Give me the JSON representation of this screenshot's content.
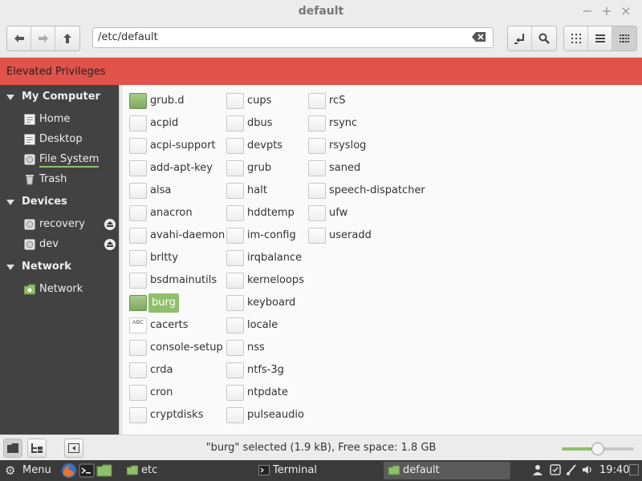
{
  "window": {
    "title": "default"
  },
  "toolbar": {
    "location": "/etc/default",
    "buttons": [
      "back-icon",
      "forward-icon",
      "up-icon",
      "toggle-location-icon",
      "search-icon",
      "icon-view-icon",
      "list-view-icon",
      "compact-view-icon"
    ]
  },
  "infobar": {
    "text": "Elevated Privileges"
  },
  "sidebar": {
    "sections": [
      {
        "label": "My Computer",
        "items": [
          {
            "label": "Home",
            "icon": "home-icon"
          },
          {
            "label": "Desktop",
            "icon": "desktop-icon"
          },
          {
            "label": "File System",
            "icon": "drive-icon",
            "selected": true
          },
          {
            "label": "Trash",
            "icon": "trash-icon"
          }
        ]
      },
      {
        "label": "Devices",
        "items": [
          {
            "label": "recovery",
            "icon": "drive-icon",
            "eject": true
          },
          {
            "label": "dev",
            "icon": "drive-icon",
            "eject": true
          }
        ]
      },
      {
        "label": "Network",
        "items": [
          {
            "label": "Network",
            "icon": "network-icon"
          }
        ]
      }
    ]
  },
  "files": {
    "columns": [
      [
        {
          "name": "grub.d",
          "type": "folder"
        },
        {
          "name": "acpid",
          "type": "file"
        },
        {
          "name": "acpi-support",
          "type": "file"
        },
        {
          "name": "add-apt-key",
          "type": "file"
        },
        {
          "name": "alsa",
          "type": "file"
        },
        {
          "name": "anacron",
          "type": "file"
        },
        {
          "name": "avahi-daemon",
          "type": "file"
        },
        {
          "name": "brltty",
          "type": "file"
        },
        {
          "name": "bsdmainutils",
          "type": "file"
        },
        {
          "name": "burg",
          "type": "file",
          "selected": true
        },
        {
          "name": "cacerts",
          "type": "cert"
        },
        {
          "name": "console-setup",
          "type": "file"
        },
        {
          "name": "crda",
          "type": "file"
        },
        {
          "name": "cron",
          "type": "file"
        },
        {
          "name": "cryptdisks",
          "type": "file"
        }
      ],
      [
        {
          "name": "cups",
          "type": "file"
        },
        {
          "name": "dbus",
          "type": "file"
        },
        {
          "name": "devpts",
          "type": "file"
        },
        {
          "name": "grub",
          "type": "file"
        },
        {
          "name": "halt",
          "type": "file"
        },
        {
          "name": "hddtemp",
          "type": "file"
        },
        {
          "name": "im-config",
          "type": "file"
        },
        {
          "name": "irqbalance",
          "type": "file"
        },
        {
          "name": "kerneloops",
          "type": "file"
        },
        {
          "name": "keyboard",
          "type": "file"
        },
        {
          "name": "locale",
          "type": "file"
        },
        {
          "name": "nss",
          "type": "file"
        },
        {
          "name": "ntfs-3g",
          "type": "file"
        },
        {
          "name": "ntpdate",
          "type": "file"
        },
        {
          "name": "pulseaudio",
          "type": "file"
        }
      ],
      [
        {
          "name": "rcS",
          "type": "file"
        },
        {
          "name": "rsync",
          "type": "file"
        },
        {
          "name": "rsyslog",
          "type": "file"
        },
        {
          "name": "saned",
          "type": "file"
        },
        {
          "name": "speech-dispatcher",
          "type": "file"
        },
        {
          "name": "ufw",
          "type": "file"
        },
        {
          "name": "useradd",
          "type": "file"
        }
      ]
    ]
  },
  "statusbar": {
    "text": "\"burg\" selected (1.9 kB), Free space: 1.8 GB",
    "zoom_level": 0.5
  },
  "panel": {
    "menu_label": "Menu",
    "tasks": [
      {
        "label": "etc",
        "icon": "folder-icon",
        "active": false
      },
      {
        "label": "Terminal",
        "icon": "terminal-icon",
        "active": false
      },
      {
        "label": "default",
        "icon": "folder-icon",
        "active": true
      }
    ],
    "clock": "19:40"
  },
  "colors": {
    "accent": "#8fbf6a",
    "infobar": "#e0524a",
    "sidebar": "#424242",
    "panel": "#3a3a3a"
  },
  "icons": {
    "cacerts_glyph": "ABC"
  }
}
